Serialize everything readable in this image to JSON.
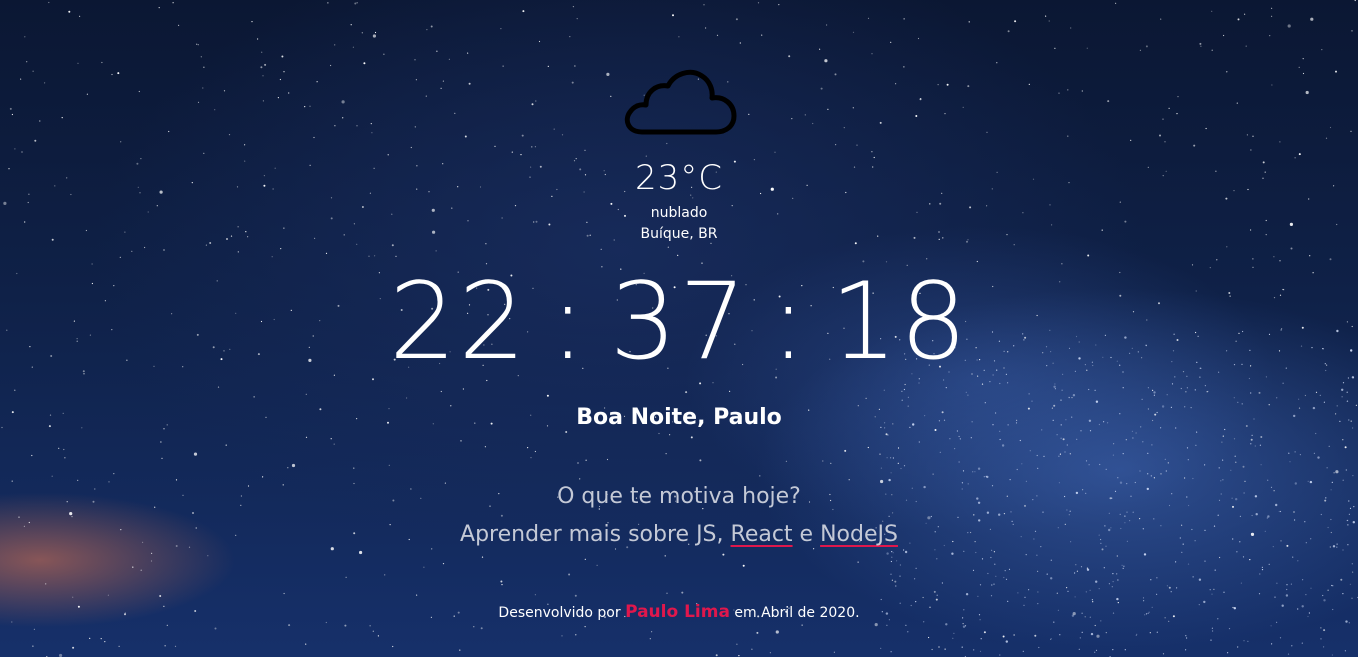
{
  "weather": {
    "icon": "cloud-icon",
    "temperature": "23°C",
    "description": "nublado",
    "location": "Buíque, BR"
  },
  "clock": {
    "hours": "22",
    "minutes": "37",
    "seconds": "18",
    "separator": ":"
  },
  "greeting": "Boa Noite, Paulo",
  "motivation": {
    "question": "O que te motiva hoje?",
    "answer_prefix": "Aprender mais sobre JS, ",
    "answer_react": "React",
    "answer_middle": " e ",
    "answer_node": "NodeJS"
  },
  "footer": {
    "prefix": "Desenvolvido por ",
    "author": "Paulo Lima",
    "suffix": " em Abril de 2020."
  },
  "colors": {
    "accent": "#e0174c",
    "text": "#ffffff",
    "muted_text": "#c4c9d6",
    "sky_dark": "#0b1733",
    "sky_light": "#16306a"
  }
}
